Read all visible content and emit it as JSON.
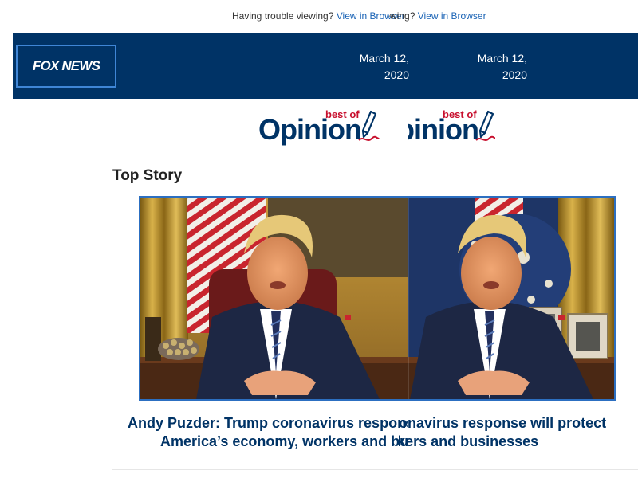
{
  "preheader": {
    "trouble_text": "Having trouble viewing?",
    "browser_link": "View in Browser"
  },
  "header": {
    "logo_text": "FOX NEWS",
    "date_line1": "March 12,",
    "date_line2": "2020"
  },
  "opinion_logo": {
    "word": "Opinion",
    "tag": "best of"
  },
  "section": {
    "title": "Top Story"
  },
  "story": {
    "headline_line1": "Andy Puzder: Trump coronavirus response will protect",
    "headline_line2": "America’s economy, workers and businesses"
  },
  "colors": {
    "header_bg": "#003366",
    "link": "#1a63b5",
    "headline": "#003366",
    "accent_red": "#c8102e"
  }
}
